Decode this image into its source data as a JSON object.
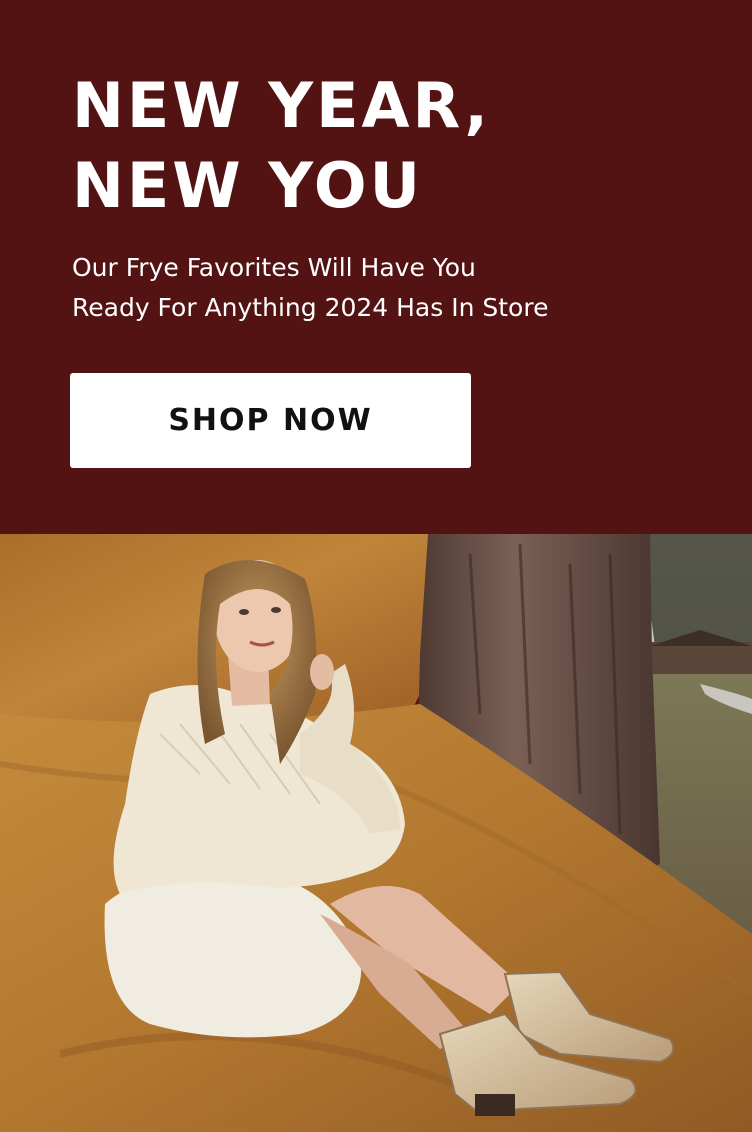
{
  "hero": {
    "headline": "NEW YEAR,\nNEW YOU",
    "subhead": "Our Frye Favorites Will Have You\nReady For Anything 2024 Has In Store",
    "cta_label": "SHOP NOW",
    "background_color": "#541313",
    "cta_background": "#ffffff"
  },
  "photo": {
    "alt": "Model in cream knit sweater and white skirt sitting on a golden backdrop wearing distressed western ankle boots beside a tree",
    "palette": {
      "backdrop": "#b47a2c",
      "bark": "#6b4e42",
      "grass": "#6f6a4a",
      "sweater": "#efe7d4",
      "boots": "#d8c4a4"
    }
  }
}
